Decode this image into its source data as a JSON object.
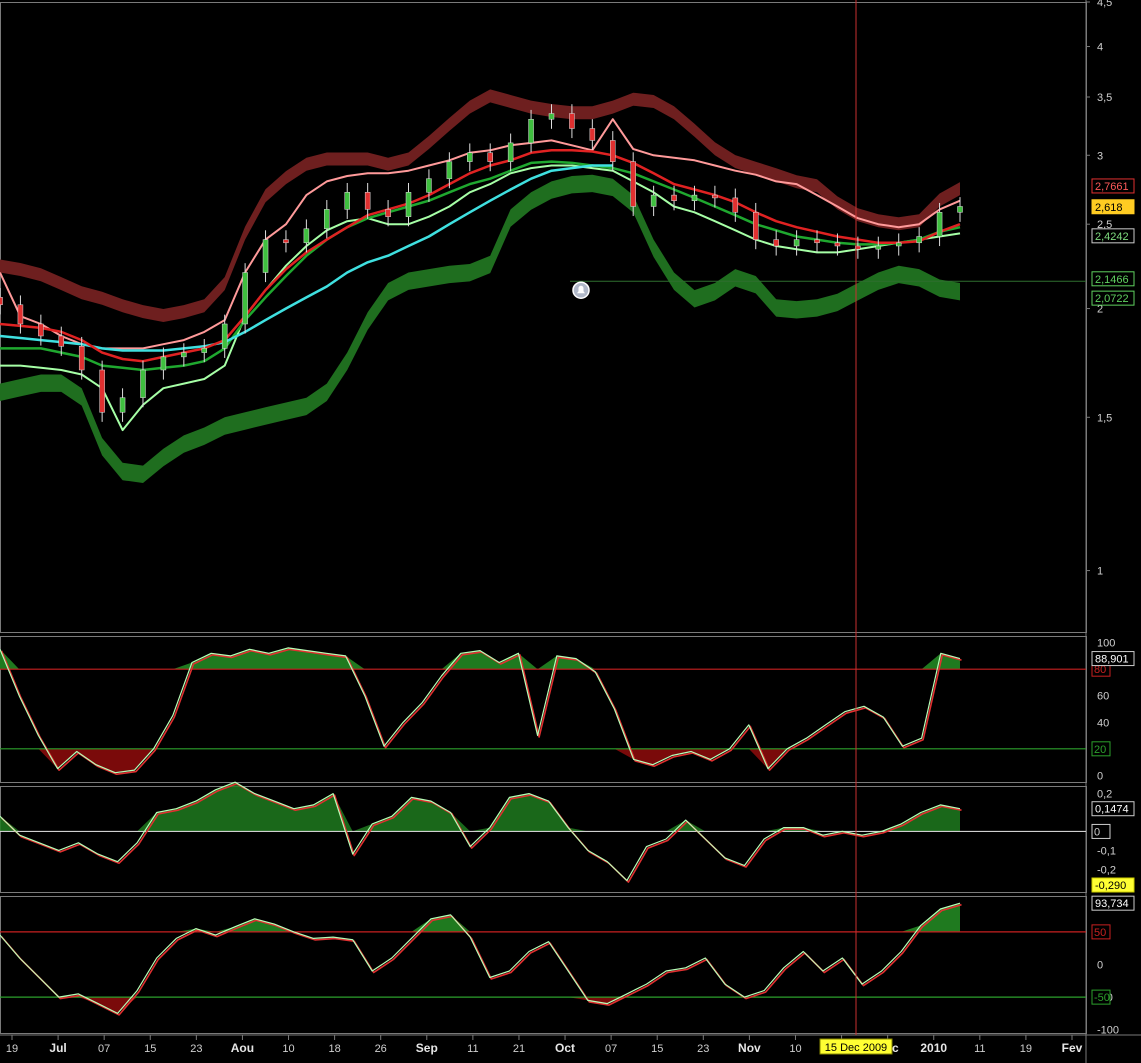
{
  "colors": {
    "background": "#000000",
    "frame": "#7a7a7a",
    "candle_up": "#3fbf3f",
    "candle_down": "#e03030",
    "upper_band": "#6e1f1f",
    "lower_band": "#1f6e1f",
    "ma_red": "#e02222",
    "ma_green": "#1fa82f",
    "ma_cyan": "#3fe0e0",
    "ma_pink": "#ff9a9a",
    "ma_lightgreen": "#a6ffa6",
    "osc_fill_up": "#1f7a1f",
    "osc_fill_down": "#7a0a0a",
    "crosshair": "#c83030",
    "highlight": "#ffff33"
  },
  "chart_data": [
    {
      "type": "line",
      "panel": "price",
      "scale": "log",
      "ylim": [
        0.85,
        4.5
      ],
      "y_ticks": [
        "4,5",
        "4",
        "3,5",
        "3",
        "2,5",
        "2",
        "1,5",
        "1"
      ],
      "x": [
        "Jun 15",
        "Jun 19",
        "Jun 23",
        "Jun 27",
        "Jul 01",
        "Jul 07",
        "Jul 11",
        "Jul 15",
        "Jul 19",
        "Jul 23",
        "Jul 27",
        "Aug 01",
        "Aug 06",
        "Aug 10",
        "Aug 14",
        "Aug 18",
        "Aug 22",
        "Aug 26",
        "Sep 01",
        "Sep 06",
        "Sep 11",
        "Sep 16",
        "Sep 21",
        "Sep 26",
        "Oct 01",
        "Oct 07",
        "Oct 11",
        "Oct 15",
        "Oct 19",
        "Oct 23",
        "Oct 27",
        "Nov 01",
        "Nov 06",
        "Nov 10",
        "Nov 14",
        "Nov 18",
        "Nov 22",
        "Nov 26",
        "Dec 01",
        "Dec 06",
        "Dec 10",
        "Dec 14",
        "Dec 18",
        "Dec 22",
        "Dec 26",
        "Dec 30",
        "Jan 04",
        "Jan 08"
      ],
      "series": [
        {
          "role": "close",
          "values": [
            2.02,
            1.92,
            1.86,
            1.81,
            1.7,
            1.52,
            1.58,
            1.7,
            1.76,
            1.78,
            1.8,
            1.92,
            2.2,
            2.4,
            2.38,
            2.47,
            2.6,
            2.72,
            2.6,
            2.55,
            2.72,
            2.82,
            2.95,
            3.02,
            2.95,
            3.1,
            3.3,
            3.35,
            3.22,
            3.12,
            2.95,
            2.62,
            2.7,
            2.66,
            2.7,
            2.68,
            2.58,
            2.4,
            2.36,
            2.4,
            2.38,
            2.36,
            2.34,
            2.36,
            2.38,
            2.42,
            2.58,
            2.62
          ]
        },
        {
          "role": "upper_band",
          "values": [
            2.2,
            2.18,
            2.15,
            2.1,
            2.05,
            2.02,
            1.98,
            1.95,
            1.93,
            1.95,
            1.98,
            2.1,
            2.4,
            2.65,
            2.78,
            2.88,
            2.92,
            2.92,
            2.92,
            2.88,
            2.92,
            3.05,
            3.2,
            3.35,
            3.45,
            3.4,
            3.35,
            3.32,
            3.3,
            3.3,
            3.35,
            3.42,
            3.4,
            3.3,
            3.15,
            3.0,
            2.9,
            2.85,
            2.8,
            2.75,
            2.72,
            2.6,
            2.52,
            2.48,
            2.46,
            2.48,
            2.62,
            2.7
          ]
        },
        {
          "role": "lower_band",
          "values": [
            1.64,
            1.66,
            1.68,
            1.68,
            1.62,
            1.42,
            1.33,
            1.32,
            1.38,
            1.43,
            1.46,
            1.5,
            1.52,
            1.54,
            1.56,
            1.58,
            1.64,
            1.78,
            1.98,
            2.14,
            2.2,
            2.22,
            2.24,
            2.25,
            2.3,
            2.6,
            2.72,
            2.8,
            2.84,
            2.85,
            2.82,
            2.7,
            2.4,
            2.2,
            2.1,
            2.14,
            2.22,
            2.18,
            2.05,
            2.04,
            2.05,
            2.08,
            2.14,
            2.2,
            2.24,
            2.22,
            2.16,
            2.14
          ]
        },
        {
          "role": "ma_red",
          "values": [
            1.92,
            1.91,
            1.9,
            1.88,
            1.84,
            1.78,
            1.75,
            1.74,
            1.76,
            1.78,
            1.8,
            1.84,
            1.96,
            2.1,
            2.22,
            2.32,
            2.4,
            2.48,
            2.56,
            2.6,
            2.64,
            2.7,
            2.78,
            2.86,
            2.92,
            2.96,
            3.02,
            3.04,
            3.04,
            3.03,
            3.0,
            2.94,
            2.86,
            2.78,
            2.74,
            2.7,
            2.65,
            2.58,
            2.52,
            2.48,
            2.45,
            2.42,
            2.4,
            2.38,
            2.38,
            2.39,
            2.45,
            2.5
          ]
        },
        {
          "role": "ma_green",
          "values": [
            1.8,
            1.8,
            1.8,
            1.78,
            1.76,
            1.72,
            1.71,
            1.7,
            1.71,
            1.72,
            1.74,
            1.8,
            1.94,
            2.06,
            2.18,
            2.3,
            2.4,
            2.48,
            2.54,
            2.58,
            2.62,
            2.66,
            2.72,
            2.78,
            2.82,
            2.88,
            2.94,
            2.95,
            2.94,
            2.92,
            2.9,
            2.86,
            2.8,
            2.74,
            2.68,
            2.62,
            2.56,
            2.5,
            2.46,
            2.42,
            2.4,
            2.38,
            2.37,
            2.37,
            2.38,
            2.4,
            2.45,
            2.48
          ]
        },
        {
          "role": "ma_cyan",
          "values": [
            1.86,
            1.85,
            1.84,
            1.83,
            1.82,
            1.8,
            1.79,
            1.79,
            1.79,
            1.8,
            1.81,
            1.83,
            1.88,
            1.94,
            2.0,
            2.06,
            2.12,
            2.2,
            2.26,
            2.3,
            2.36,
            2.42,
            2.5,
            2.58,
            2.66,
            2.74,
            2.82,
            2.88,
            2.9,
            2.92,
            2.92
          ]
        },
        {
          "role": "ma_pink",
          "values": [
            2.2,
            1.96,
            1.92,
            1.86,
            1.82,
            1.8,
            1.8,
            1.8,
            1.82,
            1.84,
            1.88,
            1.94,
            2.2,
            2.4,
            2.5,
            2.7,
            2.8,
            2.84,
            2.86,
            2.86,
            2.88,
            2.92,
            2.96,
            3.02,
            3.04,
            3.08,
            3.1,
            3.12,
            3.08,
            3.04,
            3.3,
            3.05,
            3.0,
            2.98,
            2.96,
            2.92,
            2.88,
            2.85,
            2.8,
            2.78,
            2.7,
            2.62,
            2.54,
            2.5,
            2.48,
            2.5,
            2.6,
            2.66
          ]
        },
        {
          "role": "ma_lightgreen",
          "values": [
            1.72,
            1.72,
            1.71,
            1.7,
            1.68,
            1.62,
            1.45,
            1.55,
            1.62,
            1.64,
            1.66,
            1.72,
            1.96,
            2.1,
            2.24,
            2.36,
            2.46,
            2.52,
            2.54,
            2.5,
            2.5,
            2.55,
            2.62,
            2.72,
            2.78,
            2.86,
            2.9,
            2.92,
            2.92,
            2.9,
            2.88,
            2.8,
            2.72,
            2.62,
            2.58,
            2.52,
            2.46,
            2.4,
            2.36,
            2.34,
            2.32,
            2.32,
            2.34,
            2.36,
            2.38,
            2.4,
            2.42,
            2.44
          ]
        }
      ],
      "price_labels": [
        "2,7661",
        "2,618",
        "2,4242",
        "2,1466",
        "2,0722"
      ],
      "support_level": 2.15
    },
    {
      "type": "area",
      "panel": "oscillator_1",
      "ylim": [
        -5,
        105
      ],
      "y_ticks": [
        "100",
        "60",
        "40",
        "0"
      ],
      "levels": [
        {
          "value": 80,
          "label": "80",
          "color": "#c82020"
        },
        {
          "value": 20,
          "label": "20",
          "color": "#2ca02c"
        }
      ],
      "current_label": "88,901",
      "values": [
        95,
        60,
        30,
        5,
        18,
        8,
        2,
        4,
        20,
        45,
        85,
        92,
        90,
        95,
        92,
        96,
        94,
        92,
        90,
        60,
        22,
        40,
        55,
        75,
        92,
        94,
        85,
        92,
        30,
        90,
        88,
        78,
        50,
        12,
        8,
        15,
        18,
        12,
        20,
        38,
        5,
        20,
        28,
        38,
        48,
        52,
        44,
        22,
        28,
        92,
        88
      ]
    },
    {
      "type": "area",
      "panel": "oscillator_2",
      "ylim": [
        -0.32,
        0.24
      ],
      "y_ticks": [
        "0,2",
        "0",
        "-0,1",
        "-0,2"
      ],
      "levels": [
        {
          "value": 0,
          "label": "0",
          "color": "#cfcfcf"
        }
      ],
      "current_label": "0,1474",
      "low_label": "-0,290",
      "values": [
        0.08,
        -0.02,
        -0.06,
        -0.1,
        -0.06,
        -0.12,
        -0.16,
        -0.06,
        0.1,
        0.12,
        0.16,
        0.22,
        0.26,
        0.2,
        0.16,
        0.12,
        0.14,
        0.2,
        -0.12,
        0.04,
        0.08,
        0.18,
        0.16,
        0.1,
        -0.08,
        0.02,
        0.18,
        0.2,
        0.16,
        0.02,
        -0.1,
        -0.16,
        -0.26,
        -0.08,
        -0.04,
        0.06,
        -0.04,
        -0.14,
        -0.18,
        -0.04,
        0.02,
        0.02,
        -0.02,
        0.0,
        -0.02,
        0.0,
        0.04,
        0.1,
        0.14,
        0.12
      ]
    },
    {
      "type": "area",
      "panel": "oscillator_3",
      "ylim": [
        -105,
        105
      ],
      "y_ticks": [
        "50",
        "0",
        "-50",
        "-100"
      ],
      "levels": [
        {
          "value": 50,
          "label": "50",
          "color": "#c82020"
        },
        {
          "value": -50,
          "label": "-50",
          "color": "#2ca02c"
        }
      ],
      "current_label": "93,734",
      "values": [
        45,
        10,
        -20,
        -50,
        -45,
        -60,
        -75,
        -40,
        10,
        40,
        55,
        45,
        58,
        70,
        62,
        50,
        40,
        42,
        38,
        -10,
        10,
        40,
        70,
        76,
        42,
        -20,
        -10,
        20,
        35,
        -10,
        -55,
        -60,
        -45,
        -30,
        -10,
        -5,
        10,
        -30,
        -50,
        -40,
        -5,
        20,
        -10,
        10,
        -30,
        -10,
        20,
        60,
        85,
        94
      ]
    }
  ],
  "time_axis": {
    "labels": [
      {
        "text": "19",
        "month": false
      },
      {
        "text": "Jul",
        "month": true
      },
      {
        "text": "07",
        "month": false
      },
      {
        "text": "15",
        "month": false
      },
      {
        "text": "23",
        "month": false
      },
      {
        "text": "Aou",
        "month": true
      },
      {
        "text": "10",
        "month": false
      },
      {
        "text": "18",
        "month": false
      },
      {
        "text": "26",
        "month": false
      },
      {
        "text": "Sep",
        "month": true
      },
      {
        "text": "11",
        "month": false
      },
      {
        "text": "21",
        "month": false
      },
      {
        "text": "Oct",
        "month": true
      },
      {
        "text": "07",
        "month": false
      },
      {
        "text": "15",
        "month": false
      },
      {
        "text": "23",
        "month": false
      },
      {
        "text": "Nov",
        "month": true
      },
      {
        "text": "10",
        "month": false
      },
      {
        "text": "18",
        "month": false
      },
      {
        "text": "Dec",
        "month": true
      },
      {
        "text": "2010",
        "month": true
      },
      {
        "text": "11",
        "month": false
      },
      {
        "text": "19",
        "month": false
      },
      {
        "text": "Fev",
        "month": true
      }
    ],
    "cursor_date": "15 Dec 2009"
  }
}
